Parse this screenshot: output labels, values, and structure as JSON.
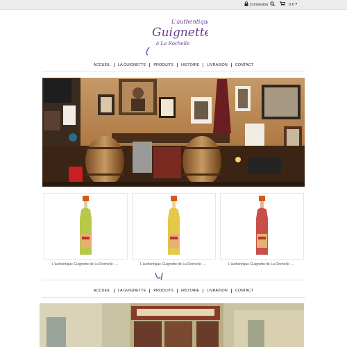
{
  "topbar": {
    "login_label": "Connexion",
    "cart_label": "0 €",
    "icons": [
      "lock-icon",
      "search-icon",
      "cart-icon",
      "chevron-down-icon"
    ]
  },
  "logo": {
    "tagline_top": "L'authentique",
    "brand": "Guignette",
    "tagline_bottom": "à La Rochelle"
  },
  "nav": {
    "items": [
      "ACCUEIL",
      "LA GUIGNETTE",
      "PRODUITS",
      "HISTOIRE",
      "LIVRAISON",
      "CONTACT"
    ]
  },
  "products": [
    {
      "title": "L'authentique Guignette de La Rochelle -...",
      "price": "...",
      "color": "#b8c84a"
    },
    {
      "title": "L'authentique Guignette de La Rochelle -...",
      "price": "...",
      "color": "#e3c84a"
    },
    {
      "title": "L'authentique Guignette de La Rochelle -...",
      "price": "...",
      "color": "#c8504a"
    }
  ],
  "footer_nav": {
    "items": [
      "ACCUEIL",
      "LA GUIGNETTE",
      "PRODUITS",
      "HISTOIRE",
      "LIVRAISON",
      "CONTACT"
    ]
  },
  "colors": {
    "logo_purple": "#6a3d8f",
    "topbar": "#ececec",
    "hero_warm": "#b07a45"
  }
}
